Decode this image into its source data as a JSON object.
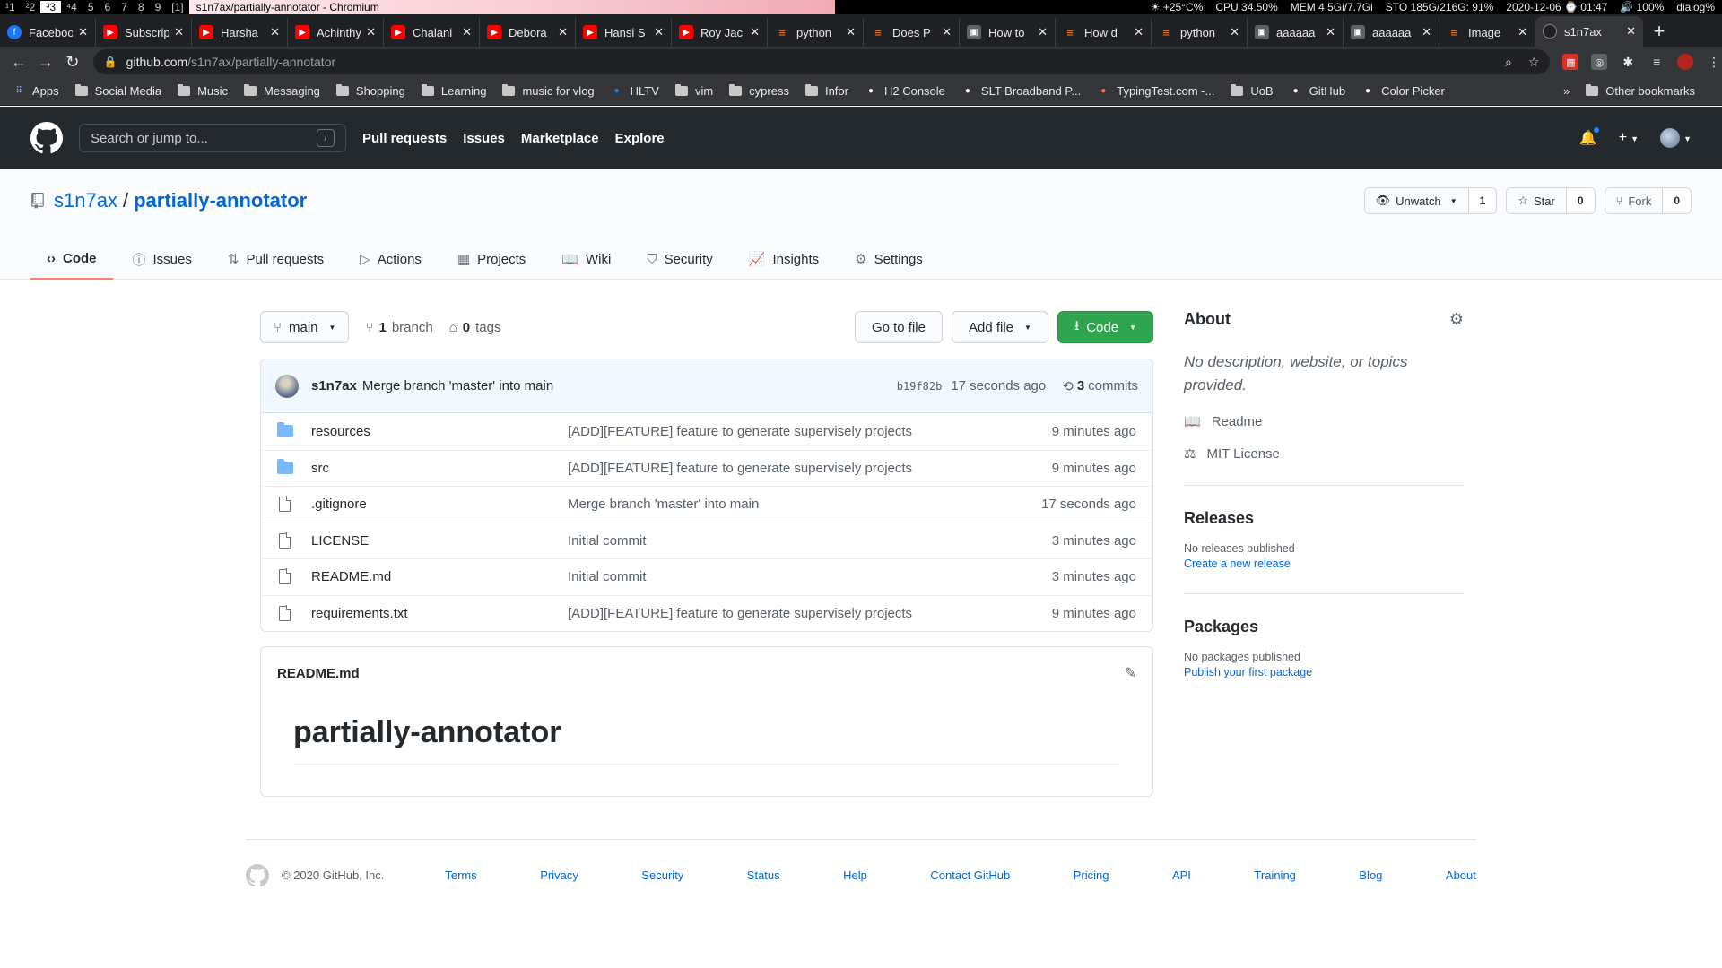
{
  "sysbar": {
    "workspaces": [
      "¹1",
      "²2",
      "³3",
      "⁴4",
      "5",
      "6",
      "7",
      "8",
      "9",
      "[1]"
    ],
    "window_title": "s1n7ax/partially-annotator - Chromium",
    "stats": [
      "☀ +25°C%",
      "CPU 34.50%",
      "MEM 4.5Gi/7.7Gi",
      "STO 185G/216G: 91%",
      "2020-12-06 ⌚ 01:47",
      "🔊 100%",
      "dialog%"
    ]
  },
  "tabs": [
    {
      "label": "Facebook",
      "fav": "fb"
    },
    {
      "label": "Subscriptions",
      "fav": "yt"
    },
    {
      "label": "Harsha",
      "fav": "yt"
    },
    {
      "label": "Achinthya",
      "fav": "yt"
    },
    {
      "label": "Chalani",
      "fav": "yt"
    },
    {
      "label": "Debora",
      "fav": "yt"
    },
    {
      "label": "Hansi S",
      "fav": "yt"
    },
    {
      "label": "Roy Jac",
      "fav": "yt"
    },
    {
      "label": "python",
      "fav": "so"
    },
    {
      "label": "Does P",
      "fav": "so"
    },
    {
      "label": "How to",
      "fav": "img"
    },
    {
      "label": "How d",
      "fav": "so"
    },
    {
      "label": "python",
      "fav": "so"
    },
    {
      "label": "aaaaaa",
      "fav": "img"
    },
    {
      "label": "aaaaaa",
      "fav": "img"
    },
    {
      "label": "Image",
      "fav": "so"
    },
    {
      "label": "s1n7ax",
      "fav": "gh",
      "active": true
    }
  ],
  "omnibox": {
    "host": "github.com",
    "path": "/s1n7ax/partially-annotator"
  },
  "bookmarks": [
    {
      "label": "Apps",
      "kind": "apps"
    },
    {
      "label": "Social Media",
      "kind": "folder"
    },
    {
      "label": "Music",
      "kind": "folder"
    },
    {
      "label": "Messaging",
      "kind": "folder"
    },
    {
      "label": "Shopping",
      "kind": "folder"
    },
    {
      "label": "Learning",
      "kind": "folder"
    },
    {
      "label": "music for vlog",
      "kind": "folder"
    },
    {
      "label": "HLTV",
      "kind": "site"
    },
    {
      "label": "vim",
      "kind": "folder"
    },
    {
      "label": "cypress",
      "kind": "folder"
    },
    {
      "label": "Infor",
      "kind": "folder"
    },
    {
      "label": "H2 Console",
      "kind": "site"
    },
    {
      "label": "SLT Broadband P...",
      "kind": "site"
    },
    {
      "label": "TypingTest.com -...",
      "kind": "site"
    },
    {
      "label": "UoB",
      "kind": "folder"
    },
    {
      "label": "GitHub",
      "kind": "site"
    },
    {
      "label": "Color Picker",
      "kind": "site"
    }
  ],
  "bookmarks_other": "Other bookmarks",
  "gh": {
    "search_placeholder": "Search or jump to...",
    "search_key": "/",
    "nav": [
      "Pull requests",
      "Issues",
      "Marketplace",
      "Explore"
    ]
  },
  "repo": {
    "owner": "s1n7ax",
    "name": "partially-annotator",
    "watch_label": "Unwatch",
    "watch_count": "1",
    "star_label": "Star",
    "star_count": "0",
    "fork_label": "Fork",
    "fork_count": "0",
    "tabs": [
      {
        "label": "Code",
        "icon": "code-icon",
        "glyph": "‹›",
        "selected": true
      },
      {
        "label": "Issues",
        "icon": "issue-icon",
        "glyph": "ⓘ"
      },
      {
        "label": "Pull requests",
        "icon": "pull-request-icon",
        "glyph": "⇅"
      },
      {
        "label": "Actions",
        "icon": "play-icon",
        "glyph": "▷"
      },
      {
        "label": "Projects",
        "icon": "project-icon",
        "glyph": "▦"
      },
      {
        "label": "Wiki",
        "icon": "book-icon",
        "glyph": "📖"
      },
      {
        "label": "Security",
        "icon": "shield-icon",
        "glyph": "⛉"
      },
      {
        "label": "Insights",
        "icon": "graph-icon",
        "glyph": "📈"
      },
      {
        "label": "Settings",
        "icon": "gear-icon",
        "glyph": "⚙"
      }
    ]
  },
  "filenav": {
    "branch": "main",
    "branch_count": "1",
    "branch_label": "branch",
    "tag_count": "0",
    "tag_label": "tags",
    "go_to_file": "Go to file",
    "add_file": "Add file",
    "code": "Code"
  },
  "commit": {
    "author": "s1n7ax",
    "message": "Merge branch 'master' into main",
    "sha": "b19f82b",
    "age": "17 seconds ago",
    "count": "3",
    "count_label": "commits"
  },
  "files": [
    {
      "type": "dir",
      "name": "resources",
      "message": "[ADD][FEATURE] feature to generate supervisely projects",
      "age": "9 minutes ago"
    },
    {
      "type": "dir",
      "name": "src",
      "message": "[ADD][FEATURE] feature to generate supervisely projects",
      "age": "9 minutes ago"
    },
    {
      "type": "file",
      "name": ".gitignore",
      "message": "Merge branch 'master' into main",
      "age": "17 seconds ago"
    },
    {
      "type": "file",
      "name": "LICENSE",
      "message": "Initial commit",
      "age": "3 minutes ago"
    },
    {
      "type": "file",
      "name": "README.md",
      "message": "Initial commit",
      "age": "3 minutes ago"
    },
    {
      "type": "file",
      "name": "requirements.txt",
      "message": "[ADD][FEATURE] feature to generate supervisely projects",
      "age": "9 minutes ago"
    }
  ],
  "readme": {
    "filename": "README.md",
    "heading": "partially-annotator"
  },
  "sidebar": {
    "about_title": "About",
    "about_desc": "No description, website, or topics provided.",
    "readme_link": "Readme",
    "license_link": "MIT License",
    "releases_title": "Releases",
    "releases_none": "No releases published",
    "releases_create": "Create a new release",
    "packages_title": "Packages",
    "packages_none": "No packages published",
    "packages_publish": "Publish your first package"
  },
  "footer": {
    "copyright": "© 2020 GitHub, Inc.",
    "links": [
      "Terms",
      "Privacy",
      "Security",
      "Status",
      "Help",
      "Contact GitHub",
      "Pricing",
      "API",
      "Training",
      "Blog",
      "About"
    ]
  },
  "colors": {
    "accent_link": "#0366d6",
    "header_bg": "#24292e",
    "green_button": "#2ea44f",
    "selected_tab_underline": "#f9826c"
  }
}
